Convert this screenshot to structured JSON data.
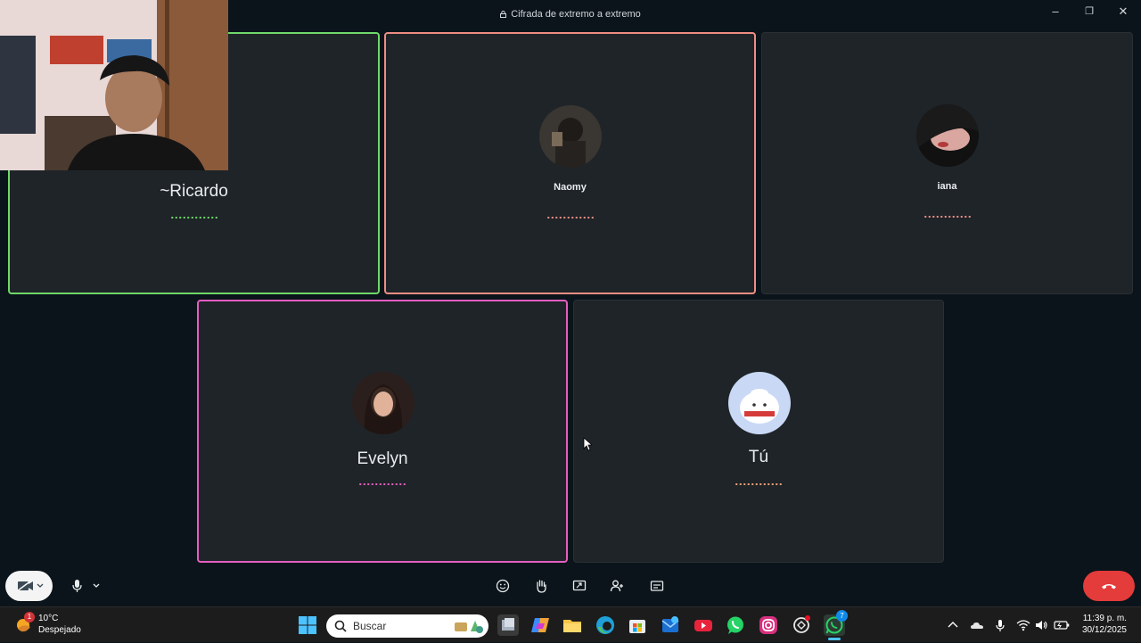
{
  "window": {
    "title": "Cifrada de extremo a extremo",
    "minimize": "–",
    "maximize": "❐",
    "close": "✕"
  },
  "participants": [
    {
      "name": "~Ricardo",
      "speaking_color": "#6fd86a",
      "dots_color": "#6fd86a"
    },
    {
      "name": "Naomy",
      "speaking_color": "#f08d84",
      "dots_color": "#f08d84"
    },
    {
      "name": "iana",
      "speaking_color": "",
      "dots_color": "#f08d84"
    },
    {
      "name": "Evelyn",
      "speaking_color": "#e45ec1",
      "dots_color": "#e45ec1"
    },
    {
      "name": "Tú",
      "speaking_color": "",
      "dots_color": "#f0a07a"
    }
  ],
  "controls": {
    "camera": "camera-off-icon",
    "mic": "mic-icon",
    "reactions": "emoji-icon",
    "raise_hand": "hand-icon",
    "share_screen": "screen-share-icon",
    "participants": "people-icon",
    "captions": "captions-icon",
    "end_call": "end-call-icon",
    "end_call_color": "#e43b3b"
  },
  "taskbar": {
    "weather_badge": "1",
    "weather_temp": "10°C",
    "weather_desc": "Despejado",
    "search_placeholder": "Buscar",
    "time": "11:39 p. m.",
    "date": "30/12/2025",
    "whatsapp_badge": "7"
  }
}
